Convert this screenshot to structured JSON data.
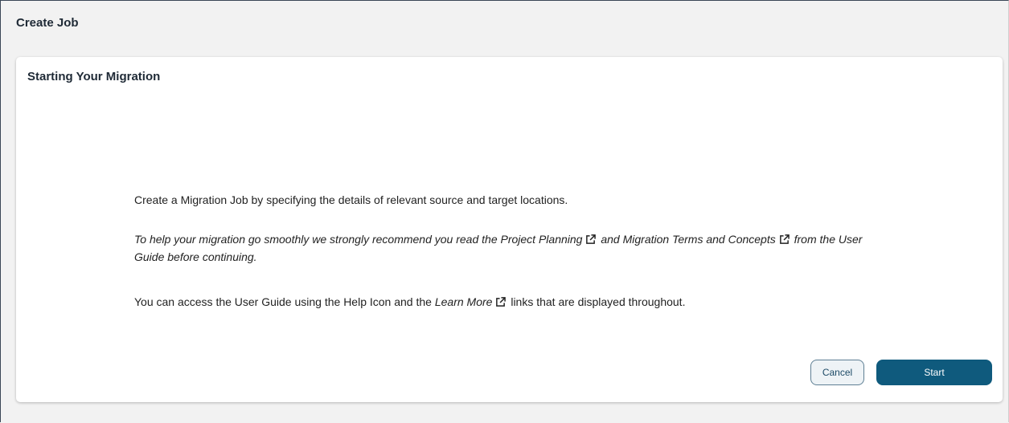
{
  "header": {
    "title": "Create Job"
  },
  "card": {
    "title": "Starting Your Migration",
    "intro": "Create a Migration Job by specifying the details of relevant source and target locations.",
    "recommend": {
      "prefix": "To help your migration go smoothly we strongly recommend you read the ",
      "link1": "Project Planning",
      "middle": " and ",
      "link2": "Migration Terms and Concepts",
      "suffix": " from the User Guide before continuing."
    },
    "access": {
      "prefix": "You can access the User Guide using the Help Icon and the ",
      "link": "Learn More",
      "suffix": " links that are displayed throughout."
    }
  },
  "buttons": {
    "cancel": "Cancel",
    "start": "Start"
  },
  "icons": {
    "external": "external-link-icon"
  },
  "colors": {
    "primary": "#0f5a7d",
    "cancel_border": "#5e7f94",
    "title": "#1f2a36"
  }
}
